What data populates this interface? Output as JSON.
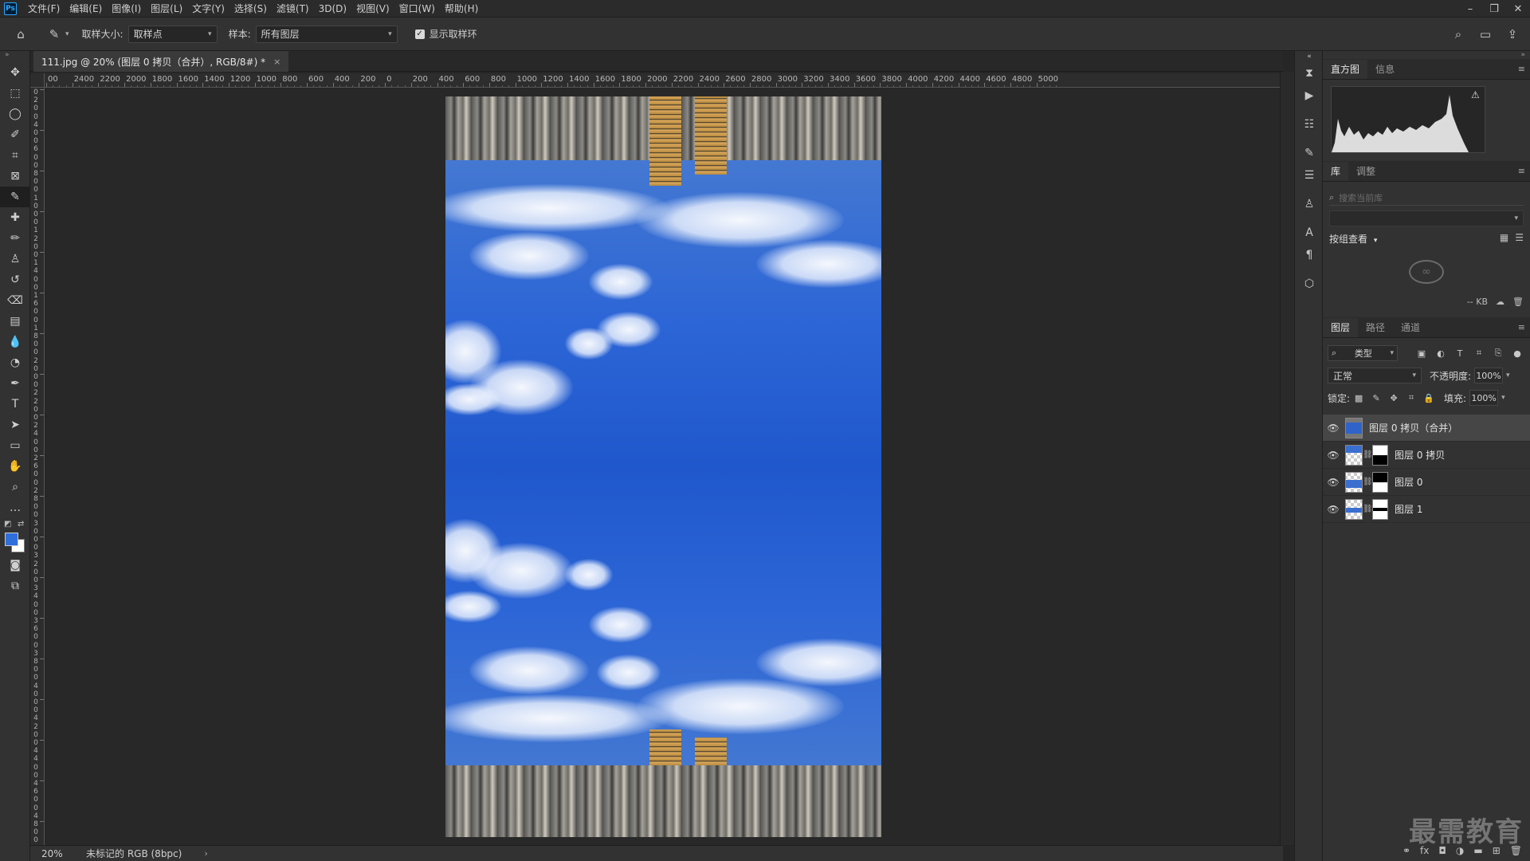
{
  "app": {
    "logo": "Ps"
  },
  "menu": [
    "文件(F)",
    "编辑(E)",
    "图像(I)",
    "图层(L)",
    "文字(Y)",
    "选择(S)",
    "滤镜(T)",
    "3D(D)",
    "视图(V)",
    "窗口(W)",
    "帮助(H)"
  ],
  "window_controls": {
    "minimize": "–",
    "restore": "❐",
    "close": "✕"
  },
  "options": {
    "sample_size_label": "取样大小:",
    "sample_size_value": "取样点",
    "sample_label": "样本:",
    "sample_value": "所有图层",
    "show_ring_label": "显示取样环",
    "show_ring_checked": true
  },
  "document": {
    "tab_title": "111.jpg @ 20% (图层 0 拷贝（合并）, RGB/8#) *",
    "zoom": "20%",
    "profile": "未标记的 RGB (8bpc)"
  },
  "ruler": {
    "h_labels": [
      "00",
      "2400",
      "2200",
      "2000",
      "1800",
      "1600",
      "1400",
      "1200",
      "1000",
      "800",
      "600",
      "400",
      "200",
      "0",
      "200",
      "400",
      "600",
      "800",
      "1000",
      "1200",
      "1400",
      "1600",
      "1800",
      "2000",
      "2200",
      "2400",
      "2600",
      "2800",
      "3000",
      "3200",
      "3400",
      "3600",
      "3800",
      "4000",
      "4200",
      "4400",
      "4600",
      "4800",
      "5000"
    ],
    "v_labels": [
      "0",
      "2",
      "0",
      "0",
      "4",
      "0",
      "0",
      "6",
      "0",
      "0",
      "8",
      "0",
      "0",
      "1",
      "0",
      "0",
      "0",
      "1",
      "2",
      "0",
      "0",
      "1",
      "4",
      "0",
      "0",
      "1",
      "6",
      "0",
      "0",
      "1",
      "8",
      "0",
      "0",
      "2",
      "0",
      "0",
      "0",
      "2",
      "2",
      "0",
      "0",
      "2",
      "4",
      "0",
      "0",
      "2",
      "6",
      "0",
      "0",
      "2",
      "8",
      "0",
      "0",
      "3",
      "0",
      "0",
      "0",
      "3",
      "2",
      "0",
      "0",
      "3",
      "4",
      "0",
      "0",
      "3",
      "6",
      "0",
      "0",
      "3",
      "8",
      "0",
      "0",
      "4",
      "0",
      "0",
      "0",
      "4",
      "2",
      "0",
      "0",
      "4",
      "4",
      "0",
      "0",
      "4",
      "6",
      "0",
      "0",
      "4",
      "8",
      "0",
      "0"
    ]
  },
  "panels": {
    "histogram": {
      "tabs": [
        "直方图",
        "信息"
      ]
    },
    "library": {
      "tabs": [
        "库",
        "调整"
      ],
      "search_placeholder": "搜索当前库",
      "group_label": "按组查看",
      "size": "-- KB"
    },
    "layers": {
      "tabs": [
        "图层",
        "路径",
        "通道"
      ],
      "kind_label": "类型",
      "blend_mode": "正常",
      "opacity_label": "不透明度:",
      "opacity_value": "100%",
      "lock_label": "锁定:",
      "fill_label": "填充:",
      "fill_value": "100%",
      "items": [
        {
          "name": "图层 0 拷贝（合并）",
          "selected": true,
          "has_mask": false
        },
        {
          "name": "图层 0 拷贝",
          "selected": false,
          "has_mask": true
        },
        {
          "name": "图层 0",
          "selected": false,
          "has_mask": true
        },
        {
          "name": "图层 1",
          "selected": false,
          "has_mask": true
        }
      ]
    }
  },
  "watermark": "最需教育",
  "colors": {
    "foreground": "#2f6fdc",
    "background": "#ffffff",
    "accent": "#31a8ff"
  }
}
